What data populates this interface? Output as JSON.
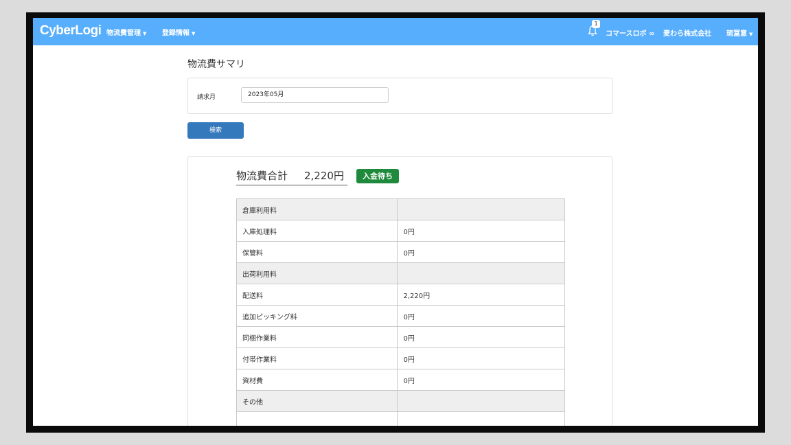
{
  "navbar": {
    "logo": "CyberLogi",
    "menus": [
      {
        "label": "物流費管理"
      },
      {
        "label": "登録情報"
      }
    ],
    "notification_count": "1",
    "shop_name": "コマースロボ ∞",
    "company": "麦わら株式会社",
    "user": "琉冨意"
  },
  "page": {
    "title": "物流費サマリ"
  },
  "search": {
    "month_label": "請求月",
    "month_value": "2023年05月",
    "button_label": "検索"
  },
  "summary": {
    "total_label": "物流費合計",
    "total_value": "2,220円",
    "status": "入金待ち",
    "status_color": "#1f8a3b"
  },
  "fees": [
    {
      "label": "倉庫利用料",
      "value": "",
      "category": true
    },
    {
      "label": "入庫処理料",
      "value": "0円",
      "category": false
    },
    {
      "label": "保管料",
      "value": "0円",
      "category": false
    },
    {
      "label": "出荷利用料",
      "value": "",
      "category": true
    },
    {
      "label": "配送料",
      "value": "2,220円",
      "category": false
    },
    {
      "label": "追加ピッキング料",
      "value": "0円",
      "category": false
    },
    {
      "label": "同梱作業料",
      "value": "0円",
      "category": false
    },
    {
      "label": "付帯作業料",
      "value": "0円",
      "category": false
    },
    {
      "label": "資材費",
      "value": "0円",
      "category": false
    },
    {
      "label": "その他",
      "value": "",
      "category": true
    },
    {
      "label": "",
      "value": "",
      "category": false
    }
  ],
  "colors": {
    "navbar": "#57aefc",
    "primary_button": "#3479bb"
  }
}
